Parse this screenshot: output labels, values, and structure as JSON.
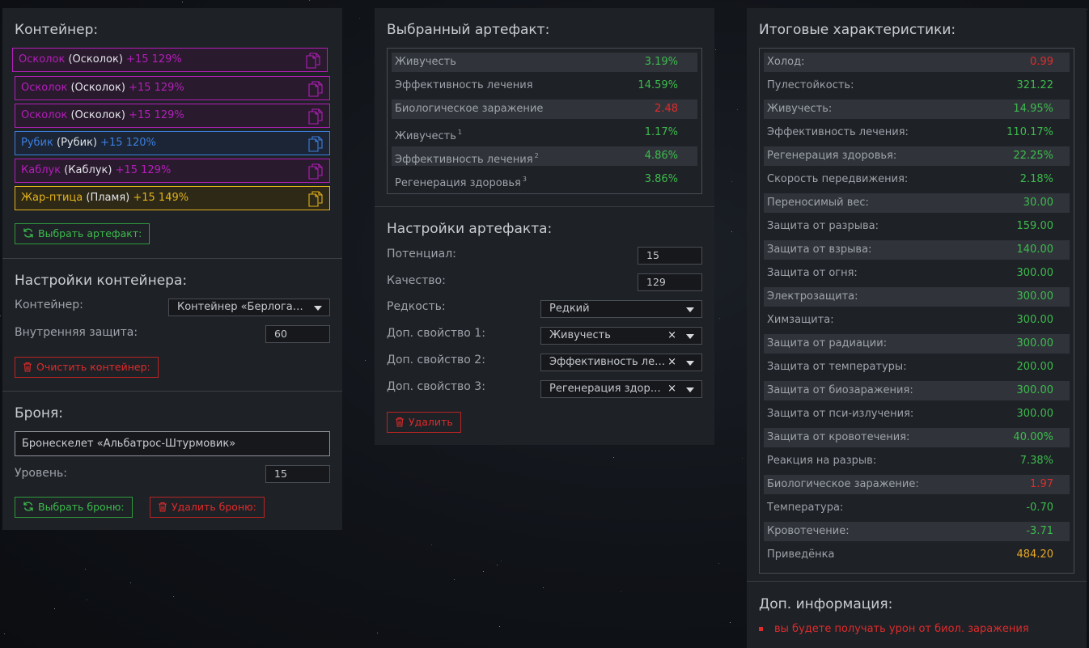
{
  "colors": {
    "purple": "#b21fb8",
    "blue": "#3c7fe0",
    "gold": "#e2b21a",
    "green": "#3dbb4d",
    "red": "#e02b2b",
    "orange": "#e6a823"
  },
  "container": {
    "title": "Контейнер:",
    "artifacts": [
      {
        "name": "Осколок",
        "paren": "(Осколок)",
        "bonus": "+15 129%",
        "rarity": "purple"
      },
      {
        "name": "Осколок",
        "paren": "(Осколок)",
        "bonus": "+15 129%",
        "rarity": "purple"
      },
      {
        "name": "Осколок",
        "paren": "(Осколок)",
        "bonus": "+15 129%",
        "rarity": "purple"
      },
      {
        "name": "Рубик",
        "paren": "(Рубик)",
        "bonus": "+15 120%",
        "rarity": "blue"
      },
      {
        "name": "Каблук",
        "paren": "(Каблук)",
        "bonus": "+15 129%",
        "rarity": "purple"
      },
      {
        "name": "Жар-птица",
        "paren": "(Пламя)",
        "bonus": "+15 149%",
        "rarity": "gold"
      }
    ],
    "choose_artifact_button": "Выбрать артефакт:"
  },
  "container_settings": {
    "title": "Настройки контейнера:",
    "container_label": "Контейнер:",
    "container_value": "Контейнер «Берлога…",
    "protection_label": "Внутренняя защита:",
    "protection_value": "60",
    "clear_button": "Очистить контейнер:"
  },
  "armor": {
    "title": "Броня:",
    "armor_value": "Бронескелет «Альбатрос-Штурмовик»",
    "level_label": "Уровень:",
    "level_value": "15",
    "choose_button": "Выбрать броню:",
    "delete_button": "Удалить броню:"
  },
  "selected_artifact": {
    "title": "Выбранный артефакт:",
    "stats": [
      {
        "name": "Живучесть",
        "sup": "",
        "value": "3.19%",
        "color": "green"
      },
      {
        "name": "Эффективность лечения",
        "sup": "",
        "value": "14.59%",
        "color": "green"
      },
      {
        "name": "Биологическое заражение",
        "sup": "",
        "value": "2.48",
        "color": "red"
      },
      {
        "name": "Живучесть",
        "sup": "1",
        "value": "1.17%",
        "color": "green"
      },
      {
        "name": "Эффективность лечения",
        "sup": "2",
        "value": "4.86%",
        "color": "green"
      },
      {
        "name": "Регенерация здоровья",
        "sup": "3",
        "value": "3.86%",
        "color": "green"
      }
    ]
  },
  "artifact_settings": {
    "title": "Настройки артефакта:",
    "potential_label": "Потенциал:",
    "potential_value": "15",
    "quality_label": "Качество:",
    "quality_value": "129",
    "rarity_label": "Редкость:",
    "rarity_value": "Редкий",
    "extra1_label": "Доп. свойство 1:",
    "extra1_value": "Живучесть",
    "extra2_label": "Доп. свойство 2:",
    "extra2_value": "Эффективность ле…",
    "extra3_label": "Доп. свойство 3:",
    "extra3_value": "Регенерация здор…",
    "clear_glyph": "×",
    "delete_button": "Удалить"
  },
  "totals": {
    "title": "Итоговые характеристики:",
    "stats": [
      {
        "name": "Холод:",
        "value": "0.99",
        "color": "red"
      },
      {
        "name": "Пулестойкость:",
        "value": "321.22",
        "color": "green"
      },
      {
        "name": "Живучесть:",
        "value": "14.95%",
        "color": "green"
      },
      {
        "name": "Эффективность лечения:",
        "value": "110.17%",
        "color": "green"
      },
      {
        "name": "Регенерация здоровья:",
        "value": "22.25%",
        "color": "green"
      },
      {
        "name": "Скорость передвижения:",
        "value": "2.18%",
        "color": "green"
      },
      {
        "name": "Переносимый вес:",
        "value": "30.00",
        "color": "green"
      },
      {
        "name": "Защита от разрыва:",
        "value": "159.00",
        "color": "green"
      },
      {
        "name": "Защита от взрыва:",
        "value": "140.00",
        "color": "green"
      },
      {
        "name": "Защита от огня:",
        "value": "300.00",
        "color": "green"
      },
      {
        "name": "Электрозащита:",
        "value": "300.00",
        "color": "green"
      },
      {
        "name": "Химзащита:",
        "value": "300.00",
        "color": "green"
      },
      {
        "name": "Защита от радиации:",
        "value": "300.00",
        "color": "green"
      },
      {
        "name": "Защита от температуры:",
        "value": "200.00",
        "color": "green"
      },
      {
        "name": "Защита от биозаражения:",
        "value": "300.00",
        "color": "green"
      },
      {
        "name": "Защита от пси-излучения:",
        "value": "300.00",
        "color": "green"
      },
      {
        "name": "Защита от кровотечения:",
        "value": "40.00%",
        "color": "green"
      },
      {
        "name": "Реакция на разрыв:",
        "value": "7.38%",
        "color": "green"
      },
      {
        "name": "Биологическое заражение:",
        "value": "1.97",
        "color": "red"
      },
      {
        "name": "Температура:",
        "value": "-0.70",
        "color": "green"
      },
      {
        "name": "Кровотечение:",
        "value": "-3.71",
        "color": "green"
      },
      {
        "name": "Приведёнка",
        "value": "484.20",
        "color": "orange"
      }
    ]
  },
  "extra_info": {
    "title": "Доп. информация:",
    "items": [
      "вы будете получать урон от биол. заражения"
    ]
  }
}
